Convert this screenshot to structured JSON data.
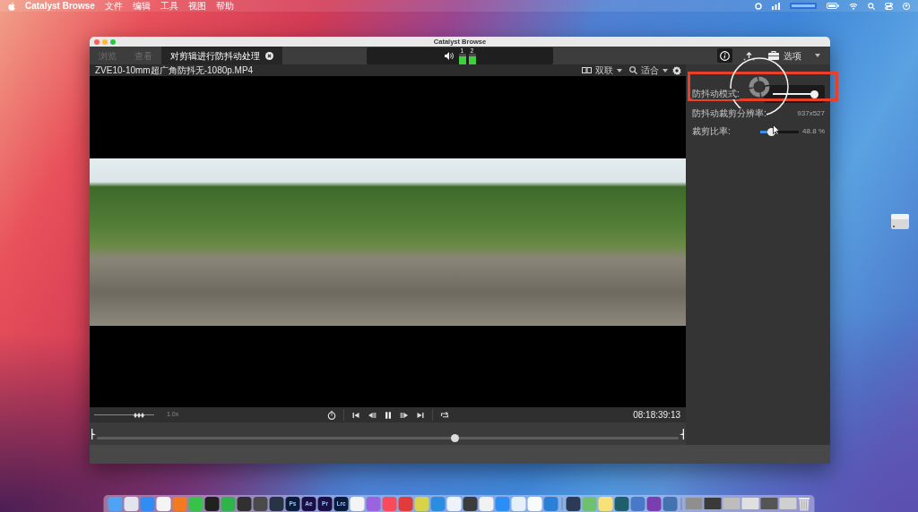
{
  "menu_bar": {
    "app": "Catalyst Browse",
    "menus": [
      "文件",
      "编辑",
      "工具",
      "视图",
      "帮助"
    ]
  },
  "window": {
    "title": "Catalyst Browse"
  },
  "tabs": [
    {
      "label": "浏览",
      "selected": false,
      "disabled": true,
      "closable": false
    },
    {
      "label": "查看",
      "selected": false,
      "disabled": true,
      "closable": false
    },
    {
      "label": "对剪辑进行防抖动处理",
      "selected": true,
      "disabled": false,
      "closable": true
    }
  ],
  "audio_meter": {
    "channels": [
      {
        "label": "1",
        "level": 0.75
      },
      {
        "label": "2",
        "level": 0.75
      }
    ]
  },
  "toolbar_buttons": [
    {
      "kind": "info",
      "selected": true
    },
    {
      "kind": "upload",
      "selected": false
    },
    {
      "kind": "toolbox",
      "label": "选项",
      "selected": false
    },
    {
      "kind": "more",
      "selected": false
    }
  ],
  "clip": {
    "filename": "ZVE10-10mm超广角防抖无-1080p.MP4"
  },
  "view_controls": [
    {
      "kind": "layout",
      "label": "双联"
    },
    {
      "kind": "zoom",
      "label": "适合"
    },
    {
      "kind": "settings"
    }
  ],
  "settings": [
    {
      "kind": "toggle",
      "label": "防抖动模式:",
      "on": true
    },
    {
      "kind": "value",
      "label": "防抖动裁剪分辨率:",
      "value": "937x527"
    },
    {
      "kind": "slider",
      "label": "裁剪比率:",
      "level": 0.3,
      "reading": "48.8 %"
    }
  ],
  "transport": {
    "speed": {
      "level": 0.75,
      "reading": "1.0x"
    },
    "buttons": [
      {
        "kind": "timer"
      },
      {
        "kind": "skip_start"
      },
      {
        "kind": "step_back"
      },
      {
        "kind": "pause"
      },
      {
        "kind": "step_forward"
      },
      {
        "kind": "skip_end"
      },
      {
        "kind": "loop"
      }
    ],
    "timecode": "08:18:39:13"
  },
  "timeline": {
    "level": 0.615
  },
  "dock": {
    "apps": [
      {
        "color": "#4fa3f5"
      },
      {
        "color": "#e4e4ee"
      },
      {
        "color": "#2f8df5"
      },
      {
        "color": "#f4f4f4"
      },
      {
        "color": "#f47a22"
      },
      {
        "color": "#37c24a"
      },
      {
        "color": "#202020"
      },
      {
        "color": "#2fb34a"
      },
      {
        "color": "#303030"
      },
      {
        "color": "#4a4a4a"
      },
      {
        "color": "#263445"
      },
      {
        "color": "#0b1c3a",
        "label": "Ps"
      },
      {
        "color": "#1b0f45",
        "label": "Ae"
      },
      {
        "color": "#1b0f45",
        "label": "Pr"
      },
      {
        "color": "#0b1c3a",
        "label": "Lrc"
      },
      {
        "color": "#f4f4f4"
      },
      {
        "color": "#9a63e0"
      },
      {
        "color": "#fa4a5c"
      },
      {
        "color": "#e23b3b"
      },
      {
        "color": "#d9d34a"
      },
      {
        "color": "#2a8ee0"
      },
      {
        "color": "#eef3fb"
      },
      {
        "color": "#3c3c3c"
      },
      {
        "color": "#f2f2f2"
      },
      {
        "color": "#2a8ef5"
      },
      {
        "color": "#e6f0fb"
      },
      {
        "color": "#fafafa"
      },
      {
        "color": "#2a7fd6"
      }
    ],
    "recent_apps": [
      {
        "color": "#2b3a55"
      },
      {
        "color": "#6fc070"
      },
      {
        "color": "#f7e27a"
      },
      {
        "color": "#1f5f6c"
      },
      {
        "color": "#4a78c8"
      },
      {
        "color": "#7a3eb0"
      },
      {
        "color": "#4272b0"
      }
    ],
    "windows": [
      {
        "color": "#8f8f8f"
      },
      {
        "color": "#3a3a3a"
      },
      {
        "color": "#bdbdbd"
      },
      {
        "color": "#e0e0e0"
      },
      {
        "color": "#555555"
      },
      {
        "color": "#d0d0d0"
      }
    ]
  }
}
